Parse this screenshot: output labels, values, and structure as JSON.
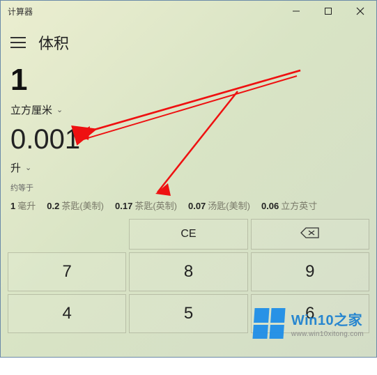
{
  "window": {
    "title": "计算器"
  },
  "header": {
    "mode": "体积"
  },
  "input": {
    "value": "1",
    "unit": "立方厘米"
  },
  "output": {
    "value": "0.001",
    "unit": "升",
    "approx_label": "约等于"
  },
  "equivalents": [
    {
      "value": "1",
      "unit": "毫升"
    },
    {
      "value": "0.2",
      "unit": "茶匙(美制)"
    },
    {
      "value": "0.17",
      "unit": "茶匙(英制)"
    },
    {
      "value": "0.07",
      "unit": "汤匙(美制)"
    },
    {
      "value": "0.06",
      "unit": "立方英寸"
    }
  ],
  "keys": {
    "ce": "CE",
    "n7": "7",
    "n8": "8",
    "n9": "9",
    "n4": "4",
    "n5": "5",
    "n6": "6"
  },
  "watermark": {
    "brand": "Win10之家",
    "url": "www.win10xitong.com"
  }
}
